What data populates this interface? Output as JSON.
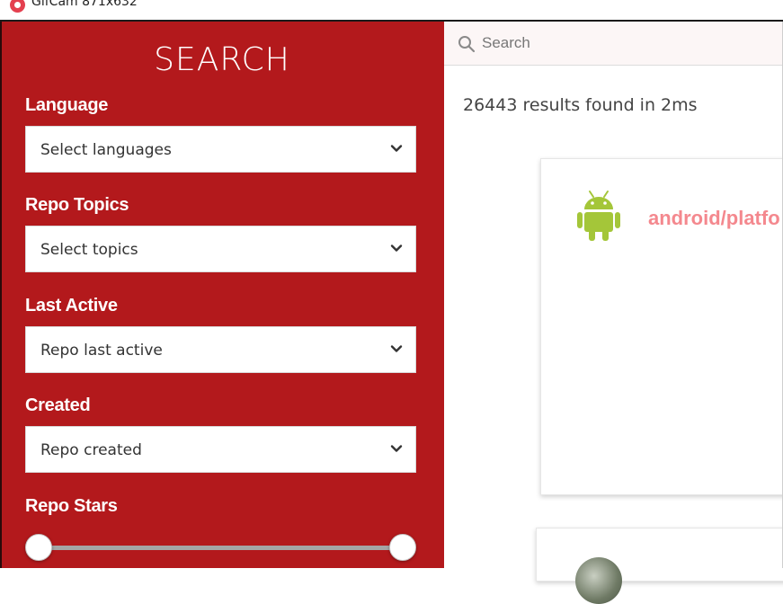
{
  "window": {
    "title": "GifCam 871x632"
  },
  "sidebar": {
    "title": "SEARCH",
    "filters": [
      {
        "label": "Language",
        "placeholder": "Select languages"
      },
      {
        "label": "Repo Topics",
        "placeholder": "Select topics"
      },
      {
        "label": "Last Active",
        "placeholder": "Repo last active"
      },
      {
        "label": "Created",
        "placeholder": "Repo created"
      }
    ],
    "stars": {
      "label": "Repo Stars",
      "range": [
        0,
        1
      ]
    }
  },
  "main": {
    "search": {
      "placeholder": "Search",
      "value": ""
    },
    "results_text": "26443 results found in 2ms",
    "cards": [
      {
        "icon": "android-icon",
        "title": "android/platfo"
      },
      {
        "icon": "avatar",
        "title": ""
      }
    ]
  },
  "colors": {
    "sidebar": "#b3191c",
    "card_title": "#f4888e",
    "android": "#a4c639"
  }
}
